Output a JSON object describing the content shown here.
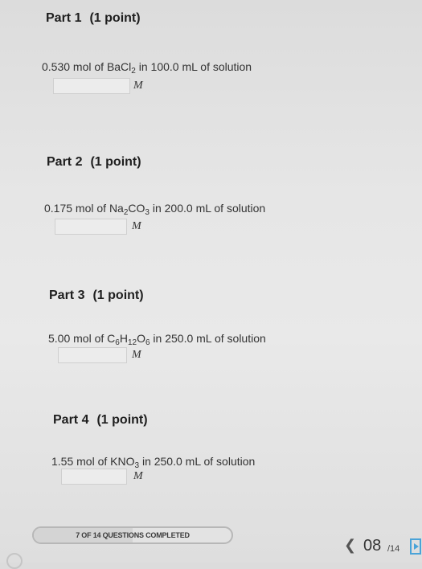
{
  "parts": [
    {
      "title": "Part 1",
      "points": "(1 point)",
      "amount": "0.530 mol of ",
      "formula": [
        {
          "t": "BaCl"
        },
        {
          "sub": "2"
        }
      ],
      "rest": " in 100.0 mL of solution",
      "answer_value": "",
      "unit": "M"
    },
    {
      "title": "Part 2",
      "points": "(1 point)",
      "amount": "0.175 mol of ",
      "formula": [
        {
          "t": "Na"
        },
        {
          "sub": "2"
        },
        {
          "t": "CO"
        },
        {
          "sub": "3"
        }
      ],
      "rest": " in 200.0 mL of solution",
      "answer_value": "",
      "unit": "M"
    },
    {
      "title": "Part 3",
      "points": "(1 point)",
      "amount": "5.00 mol of ",
      "formula": [
        {
          "t": "C"
        },
        {
          "sub": "6"
        },
        {
          "t": "H"
        },
        {
          "sub": "12"
        },
        {
          "t": "O"
        },
        {
          "sub": "6"
        }
      ],
      "rest": " in 250.0 mL of solution",
      "answer_value": "",
      "unit": "M"
    },
    {
      "title": "Part 4",
      "points": "(1 point)",
      "amount": "1.55 mol of ",
      "formula": [
        {
          "t": "KNO"
        },
        {
          "sub": "3"
        }
      ],
      "rest": " in 250.0 mL of solution",
      "answer_value": "",
      "unit": "M"
    }
  ],
  "footer": {
    "progress_label": "7 OF 14 QUESTIONS COMPLETED",
    "progress_fraction": 0.5,
    "current_page": "08",
    "total_pages": "/14",
    "prev_icon": "chevron-left-icon",
    "next_icon": "next-page-icon"
  }
}
